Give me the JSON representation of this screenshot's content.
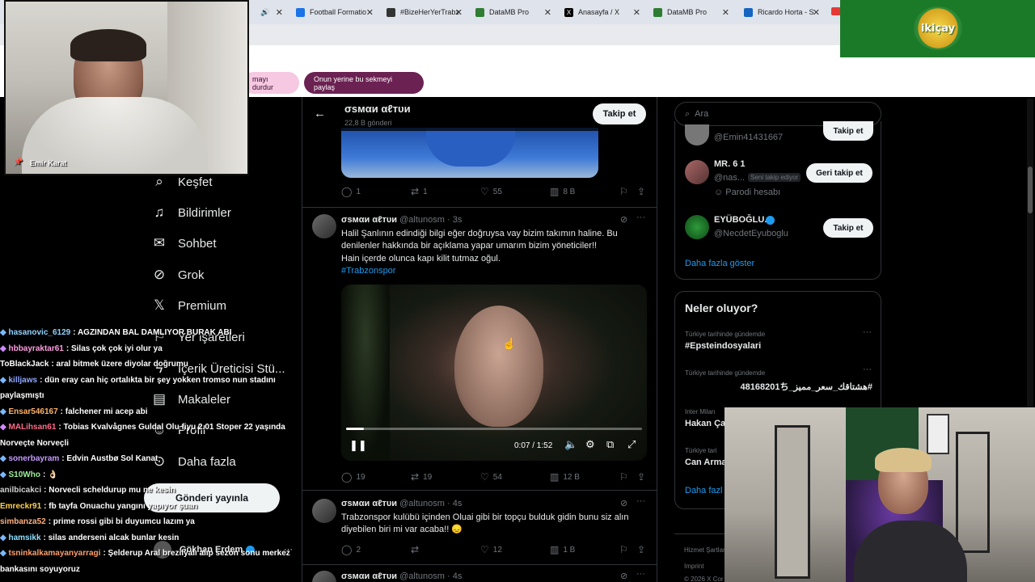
{
  "browser": {
    "tabs": [
      {
        "label": "",
        "color": "#5f6368"
      },
      {
        "label": "Football Formatio",
        "color": "#1a73e8"
      },
      {
        "label": "#BizeHerYerTrabz",
        "color": "#111111"
      },
      {
        "label": "DataMB Pro",
        "color": "#2e7d32"
      },
      {
        "label": "Anasayfa / X",
        "color": "#000000"
      },
      {
        "label": "DataMB Pro",
        "color": "#2e7d32"
      },
      {
        "label": "Ricardo Horta - S",
        "color": "#1565c0"
      }
    ],
    "share_stop": "mayı durdur",
    "share_tab": "Onun yerine bu sekmeyi paylaş"
  },
  "nav": {
    "items": [
      {
        "label": "Keşfet",
        "icon": "search-icon"
      },
      {
        "label": "Bildirimler",
        "icon": "bell-icon"
      },
      {
        "label": "Sohbet",
        "icon": "mail-icon"
      },
      {
        "label": "Grok",
        "icon": "grok-icon"
      },
      {
        "label": "Premium",
        "icon": "x-logo-icon"
      },
      {
        "label": "Yer işaretleri",
        "icon": "bookmark-icon"
      },
      {
        "label": "İçerik Üreticisi Stü...",
        "icon": "bolt-icon"
      },
      {
        "label": "Makaleler",
        "icon": "article-icon"
      },
      {
        "label": "Profil",
        "icon": "person-icon"
      },
      {
        "label": "Daha fazla",
        "icon": "more-icon"
      }
    ],
    "post_button": "Gönderi yayınla",
    "account_name": "Gökhan Erdem"
  },
  "feed": {
    "header": {
      "name": "σsмαи αℓтυи",
      "views": "22,8 B gönderi",
      "follow": "Takip et"
    },
    "tweets": [
      {
        "stats": {
          "replies": "1",
          "retweets": "1",
          "likes": "55",
          "views": "8 B"
        }
      },
      {
        "name": "σsмαи αℓтυи",
        "handle": "@altunosm",
        "time": "3s",
        "text": "Halil Şanlının edindiği bilgi eğer doğruysa vay bizim takımın haline. Bu denilenler hakkında bir açıklama yapar umarım bizim yöneticiler!!",
        "text2": "Hain içerde olunca kapı kilit tutmaz oğul.",
        "hashtag": "#Trabzonspor",
        "video_time": "0:07 / 1:52",
        "stats": {
          "replies": "19",
          "retweets": "19",
          "likes": "54",
          "views": "12 B"
        }
      },
      {
        "name": "σsмαи αℓтυи",
        "handle": "@altunosm",
        "time": "4s",
        "text": "Trabzonspor kulübü içinden Oluai gibi bir topçu bulduk gidin bunu siz alın diyebilen biri mi var acaba!! 😞",
        "stats": {
          "replies": "2",
          "retweets": "",
          "likes": "12",
          "views": "1 B"
        }
      },
      {
        "name": "σsмαи αℓтυи",
        "handle": "@altunosm",
        "time": "4s"
      }
    ]
  },
  "right": {
    "search_placeholder": "Ara",
    "follow_suggestions": [
      {
        "name": "",
        "handle": "@Emin41431667",
        "button": "Takip et"
      },
      {
        "name": "MR. 6 1",
        "handle": "@nas...",
        "badge": "Seni takip ediyor",
        "note": "Parodi hesabı",
        "button": "Geri takip et"
      },
      {
        "name": "EYÜBOĞLU.",
        "handle": "@NecdetEyuboglu",
        "button": "Takip et"
      }
    ],
    "show_more": "Daha fazla göster",
    "trends_title": "Neler oluyor?",
    "trends": [
      {
        "context": "Türkiye tarihinde gündemde",
        "title": "#Epsteindosyalari"
      },
      {
        "context": "Türkiye tarihinde gündemde",
        "title": "#هشتاقك_سعر_مميز_48168201ち"
      },
      {
        "context": "Inter Milan",
        "title": "Hakan Ça"
      },
      {
        "context": "Türkiye tari",
        "title": "Can Arma"
      }
    ],
    "trends_more": "Daha fazl",
    "footer": [
      "Hizmet Şartları",
      "Imprint",
      "© 2026 X Cor"
    ]
  },
  "chat": [
    {
      "user": "hasanovic_6129",
      "color": "#8fd3ff",
      "msg": ": AGZINDAN BAL DAMLIYOR BURAK ABI"
    },
    {
      "user": "hbbayraktar61",
      "color": "#ff9de1",
      "msg": ": Silas çok çok iyi olur ya"
    },
    {
      "user": "ToBlackJack",
      "color": "#ffffff",
      "msg": ": aral bitmek üzere diyolar doğrumu"
    },
    {
      "user": "killjaws",
      "color": "#8fa8ff",
      "msg": ": dün eray can hiç ortalıkta bir şey yokken tromso nun stadını paylaşmıştı"
    },
    {
      "user": "Ensar546167",
      "color": "#ffb46b",
      "msg": ": falchener mi acep abi"
    },
    {
      "user": "MALihsan61",
      "color": "#ff6b8a",
      "msg": ": Tobias Kvalvågnes Guldal Olu fiyu 2.01 Stoper 22 yaşında Norveçte Norveçli"
    },
    {
      "user": "sonerbayram",
      "color": "#c59bff",
      "msg": ": Edvin Austbø Sol Kanat"
    },
    {
      "user": "S10Who",
      "color": "#9bf09b",
      "msg": ": 👌🏻"
    },
    {
      "user": "anilbicakci",
      "color": "#d0d0d0",
      "msg": ": Norvecli scheldurup mu ne kesin"
    },
    {
      "user": "Emreckr91",
      "color": "#ffd24d",
      "msg": ": fb tayfa Onuachu yangını yapıyor şuan"
    },
    {
      "user": "simbanza52",
      "color": "#ffb080",
      "msg": ": prime rossi gibi bi duyumcu lazım ya"
    },
    {
      "user": "hamsikk",
      "color": "#8fe0ff",
      "msg": ": silas anderseni alcak bunlar kesin"
    },
    {
      "user": "tsninkalkamayanyarragi",
      "color": "#ff9f6b",
      "msg": ": Şelderup Aral brezilyalı alıp sezon sonu merkez bankasını soyuyoruz"
    }
  ],
  "overlays": {
    "cam_name": "Emir Karat",
    "logo": "ikiçay"
  }
}
